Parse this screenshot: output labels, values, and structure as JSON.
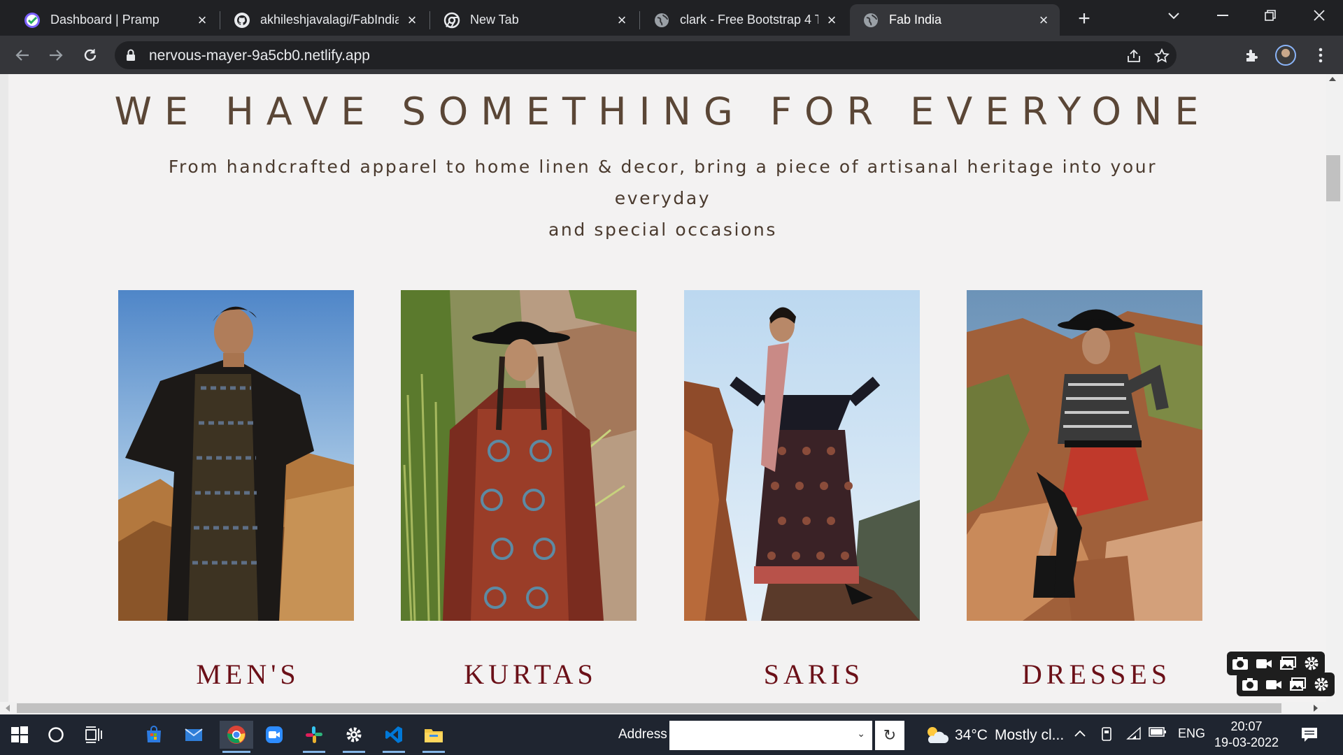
{
  "browser": {
    "tabs": [
      {
        "title": "Dashboard | Pramp",
        "icon": "pramp-check-icon"
      },
      {
        "title": "akhileshjavalagi/FabIndia-",
        "icon": "github-icon"
      },
      {
        "title": "New Tab",
        "icon": "chrome-icon"
      },
      {
        "title": "clark - Free Bootstrap 4 Te",
        "icon": "globe-icon"
      },
      {
        "title": "Fab India",
        "icon": "globe-icon",
        "active": true
      }
    ],
    "url": "nervous-mayer-9a5cb0.netlify.app"
  },
  "page": {
    "heading": "WE HAVE SOMETHING FOR EVERYONE",
    "subtext_line1": "From handcrafted apparel to home linen & decor, bring a piece of artisanal heritage into your everyday",
    "subtext_line2": "and special occasions",
    "categories": [
      {
        "label": "MEN'S",
        "image": "man-in-dark-kurta-photo"
      },
      {
        "label": "KURTAS",
        "image": "woman-in-printed-kurta-photo"
      },
      {
        "label": "SARIS",
        "image": "woman-in-saree-photo"
      },
      {
        "label": "DRESSES",
        "image": "woman-in-red-dress-photo"
      }
    ]
  },
  "taskbar": {
    "address_label": "Address",
    "address_value": "",
    "weather_temp": "34°C",
    "weather_text": "Mostly cl...",
    "language": "ENG",
    "time": "20:07",
    "date": "19-03-2022"
  },
  "colors": {
    "heading": "#5a4636",
    "category_label": "#6b1018",
    "page_bg": "#f3f2f2",
    "taskbar_bg": "#1f2530"
  }
}
